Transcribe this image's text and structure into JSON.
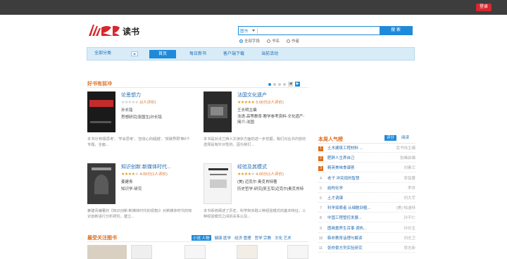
{
  "topbar": {
    "login_label": "登录"
  },
  "brand": {
    "logo_text": "读书"
  },
  "search": {
    "type_label": "图书",
    "placeholder": "",
    "button_label": "搜 索",
    "scopes": [
      "全部字段",
      "书名",
      "作者"
    ],
    "selected_scope": "全部字段"
  },
  "nav": {
    "all_categories": "全部分类",
    "items": [
      "首页",
      "每日新书",
      "客户端下载",
      "当前活动"
    ],
    "active": "首页"
  },
  "featured": {
    "title": "好书有前冲",
    "books": [
      {
        "title": "论思想力",
        "rating_text": "(0人评价)",
        "stars": 0,
        "author": "孙长铭",
        "category": "思想研究|张国生|孙长铭",
        "desc": "本书分'积极思考'、'学会思考'、'自信心的超越'、'突破界限'等6个专题。全面..."
      },
      {
        "title": "法国文化遗产",
        "rating_text": "5.00分(2人评价)",
        "stars": 5,
        "author": "王长明主编",
        "category": "法语-高等教育-教学参考资料-文化遗产-简介-法国",
        "desc": "本书是对法兰西人文读杂方面的进一步挖掘，我们对丛书内容的选择是有针对性的，因为我们..."
      },
      {
        "title": "知识创新:新媒体时代...",
        "rating_text": "4.00分(1人评价)",
        "stars": 4,
        "author": "姜建青",
        "category": "知识学-研究",
        "desc": "姜建青编著的《知识创新:新媒体时代的视角)》对新媒体时代的知识创新进行分析研究，建立..."
      },
      {
        "title": "经验及其模式",
        "rating_text": "4.00分(1人评价)",
        "stars": 4,
        "author": "(美) 迈克尔·奥克肖特著",
        "category": "历史哲学-研究|吴玉军|迈克尔|奥克肖特",
        "desc": "本书系统阐述了历史、科学和实践三种经验模式的基本特征，三种经验模式之间的关系以及..."
      }
    ]
  },
  "ranking": {
    "title": "本周人气榜",
    "tabs": [
      "评分",
      "阅读"
    ],
    "active_tab": "评分",
    "items": [
      {
        "num": "1",
        "title": "土木建筑工程材料 ...",
        "author": "武书伟主编"
      },
      {
        "num": "2",
        "title": "肥胖人生养自己",
        "author": "张峰前编"
      },
      {
        "num": "3",
        "title": "精英美味食谱荟",
        "author": "刘素兰"
      },
      {
        "num": "4",
        "title": "老子 冲突现的智慧",
        "author": "吴铭著"
      },
      {
        "num": "5",
        "title": "结构化学",
        "author": "李世"
      },
      {
        "num": "6",
        "title": "土才调课",
        "author": "刘大宇"
      },
      {
        "num": "7",
        "title": "科学探索者 从细胞到植...",
        "author": "(美) 帕迪特"
      },
      {
        "num": "8",
        "title": "中国工程管控发展...",
        "author": "孙平仁"
      },
      {
        "num": "9",
        "title": "图画童养生百事 调热...",
        "author": "孙长生"
      },
      {
        "num": "10",
        "title": "韩非教育话理与解读",
        "author": "刘志卫"
      },
      {
        "num": "11",
        "title": "张仲景方剂实验研究",
        "author": "吴志新"
      }
    ]
  },
  "focus": {
    "title": "最受关注图书",
    "subjects": [
      "小说 人物",
      "健康 医学",
      "经济 管理",
      "哲学 宗教",
      "文化 艺术"
    ],
    "active_subject": "小说 人物"
  },
  "colors": {
    "accent": "#1f8ad9",
    "brand_red": "#d7282d",
    "section_orange": "#e06d1c"
  }
}
